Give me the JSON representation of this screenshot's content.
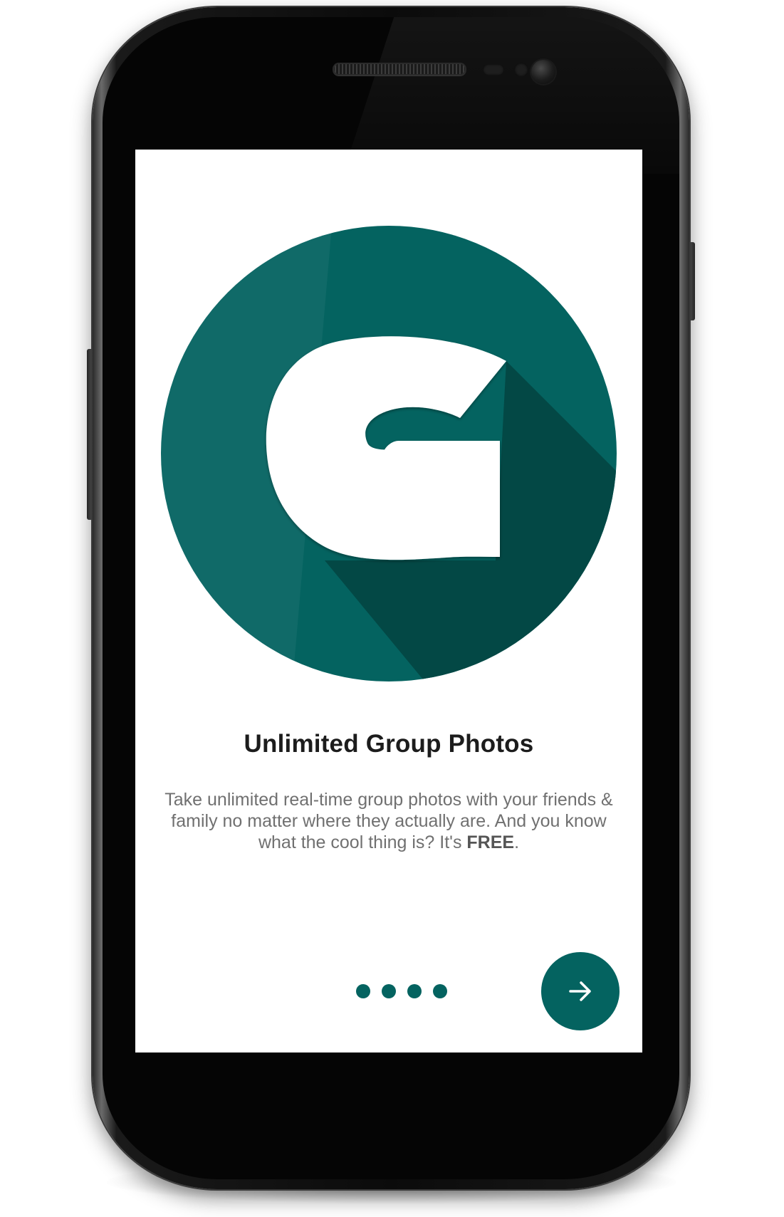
{
  "colors": {
    "brand_teal": "#046360",
    "brand_teal_shadow": "#034845",
    "title_text": "#1c1c1c",
    "body_text": "#707070",
    "screen_background": "#ffffff"
  },
  "logo": {
    "icon": "group-photo-g-logo",
    "letter": "G"
  },
  "slide": {
    "title": "Unlimited Group Photos",
    "body_text": "Take unlimited real-time group photos with your friends & family no matter where they actually are. And you know what the cool thing is? It's ",
    "body_emphasis": "FREE",
    "body_end": "."
  },
  "pager": {
    "page_count": 4,
    "icon": "page-indicator-dot"
  },
  "next_button": {
    "icon": "arrow-right-icon"
  }
}
